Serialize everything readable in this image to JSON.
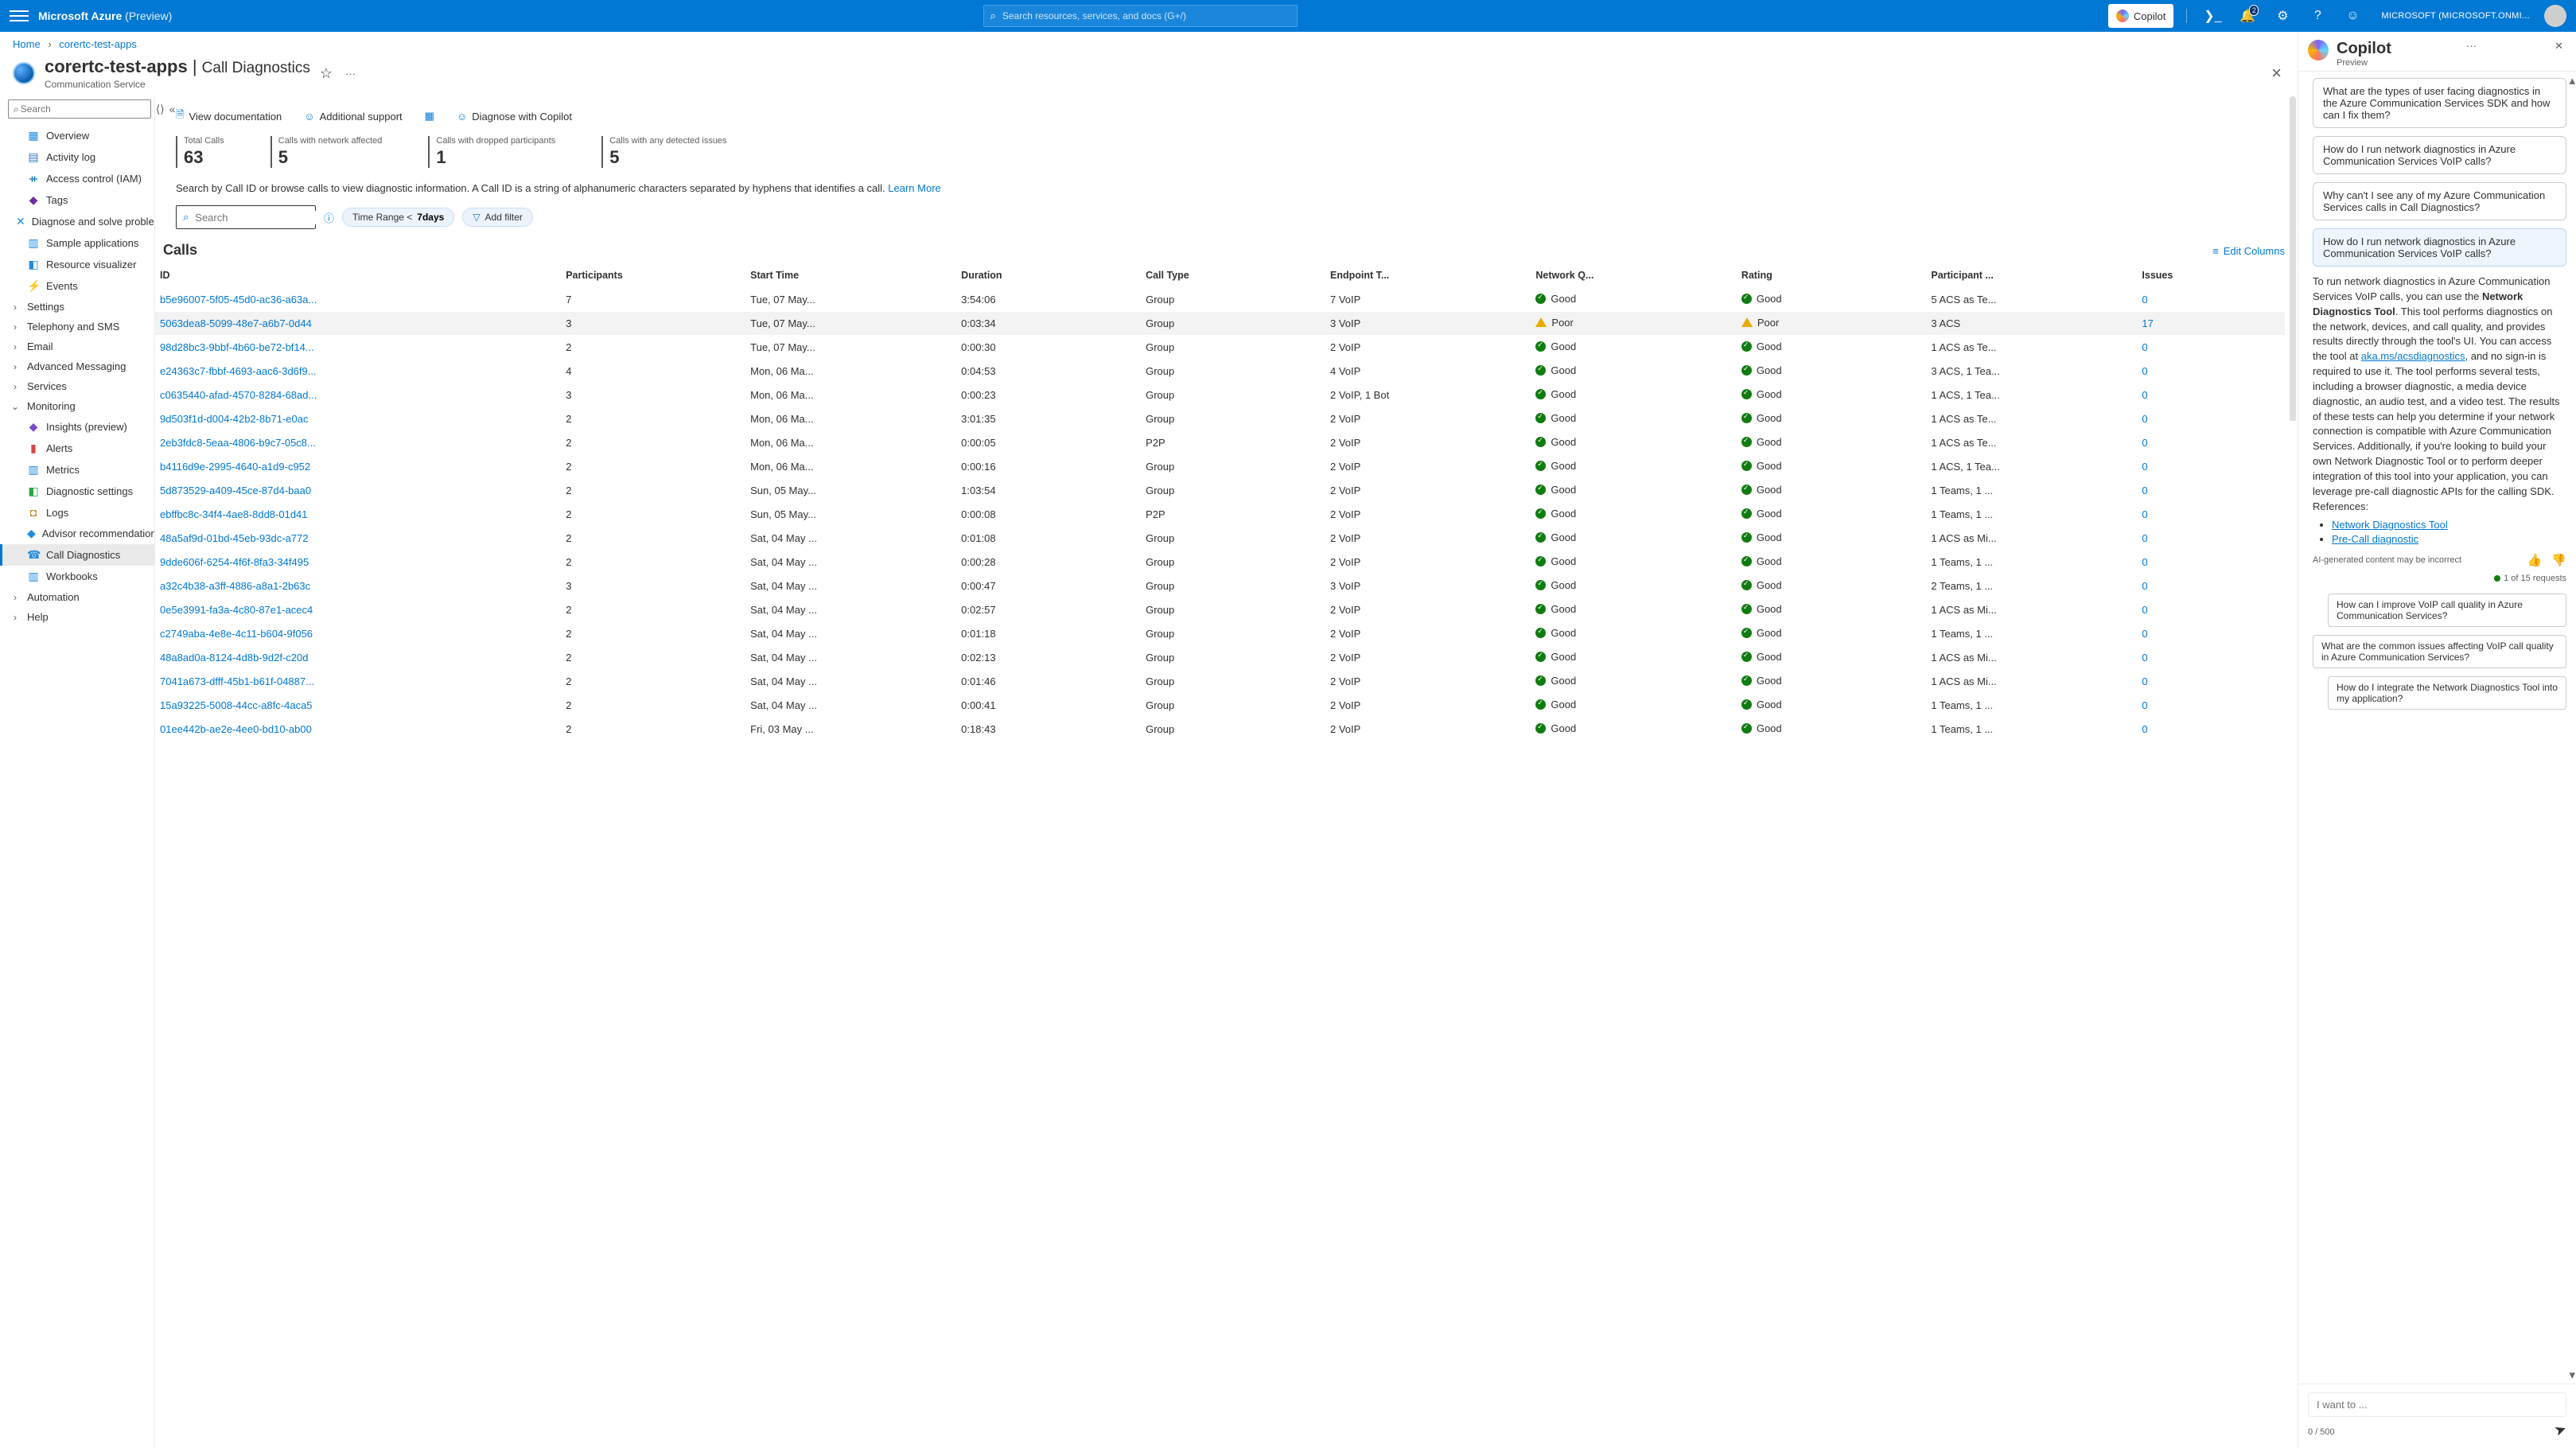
{
  "topbar": {
    "brand": "Microsoft Azure",
    "brand_suffix": " (Preview)",
    "search_placeholder": "Search resources, services, and docs (G+/)",
    "copilot_btn": "Copilot",
    "account": "MICROSOFT (MICROSOFT.ONMI...",
    "notif_count": "2"
  },
  "breadcrumb": {
    "home": "Home",
    "current": "corertc-test-apps"
  },
  "page": {
    "resource": "corertc-test-apps",
    "blade": "Call Diagnostics",
    "service_type": "Communication Service"
  },
  "svc_search_placeholder": "Search",
  "menu": {
    "items": [
      {
        "icon": "▦",
        "label": "Overview",
        "color": "#1f8bde"
      },
      {
        "icon": "▤",
        "label": "Activity log",
        "color": "#3575c0"
      },
      {
        "icon": "ᚑ",
        "label": "Access control (IAM)",
        "color": "#0f7bc2"
      },
      {
        "icon": "◆",
        "label": "Tags",
        "color": "#6b2ea3"
      },
      {
        "icon": "✕",
        "label": "Diagnose and solve problems",
        "color": "#1f8bde"
      },
      {
        "icon": "▥",
        "label": "Sample applications",
        "color": "#1f8bde"
      },
      {
        "icon": "◧",
        "label": "Resource visualizer",
        "color": "#1f8bde"
      },
      {
        "icon": "⚡",
        "label": "Events",
        "color": "#f2b200"
      }
    ],
    "groups": [
      {
        "chev": "›",
        "label": "Settings"
      },
      {
        "chev": "›",
        "label": "Telephony and SMS"
      },
      {
        "chev": "›",
        "label": "Email"
      },
      {
        "chev": "›",
        "label": "Advanced Messaging"
      },
      {
        "chev": "›",
        "label": "Services"
      }
    ],
    "monitoring": {
      "label": "Monitoring",
      "items": [
        {
          "icon": "◆",
          "label": "Insights (preview)",
          "color": "#7a49c9"
        },
        {
          "icon": "▮",
          "label": "Alerts",
          "color": "#d64343"
        },
        {
          "icon": "▥",
          "label": "Metrics",
          "color": "#1f8bde"
        },
        {
          "icon": "◧",
          "label": "Diagnostic settings",
          "color": "#28a745"
        },
        {
          "icon": "◘",
          "label": "Logs",
          "color": "#c78b27"
        },
        {
          "icon": "◆",
          "label": "Advisor recommendations",
          "color": "#1f8bde"
        },
        {
          "icon": "☎",
          "label": "Call Diagnostics",
          "color": "#1f8bde",
          "selected": true
        },
        {
          "icon": "▥",
          "label": "Workbooks",
          "color": "#1f8bde"
        }
      ]
    },
    "automation": {
      "chev": "›",
      "label": "Automation"
    },
    "help": {
      "chev": "›",
      "label": "Help"
    }
  },
  "commands": {
    "view_docs": "View documentation",
    "addl_support": "Additional support",
    "copilot": "Diagnose with Copilot"
  },
  "stats": [
    {
      "label": "Total Calls",
      "value": "63"
    },
    {
      "label": "Calls with network affected",
      "value": "5"
    },
    {
      "label": "Calls with dropped participants",
      "value": "1"
    },
    {
      "label": "Calls with any detected issues",
      "value": "5"
    }
  ],
  "instructions": {
    "text": "Search by Call ID or browse calls to view diagnostic information. A Call ID is a string of alphanumeric characters separated by hyphens that identifies a call.",
    "learn_more": "Learn More"
  },
  "search_placeholder": "Search",
  "filters": {
    "time_prefix": "Time Range <",
    "time_value": "7days",
    "add_filter": "Add filter"
  },
  "table": {
    "title": "Calls",
    "edit_columns": "Edit Columns",
    "columns": [
      "ID",
      "Participants",
      "Start Time",
      "Duration",
      "Call Type",
      "Endpoint T...",
      "Network Q...",
      "Rating",
      "Participant ...",
      "Issues"
    ],
    "rows": [
      {
        "id": "b5e96007-5f05-45d0-ac36-a63a...",
        "p": "7",
        "t": "Tue, 07 May...",
        "d": "3:54:06",
        "ct": "Group",
        "et": "7 VoIP",
        "nq": "Good",
        "r": "Good",
        "pt": "5 ACS as Te...",
        "iss": "0"
      },
      {
        "id": "5063dea8-5099-48e7-a6b7-0d44",
        "p": "3",
        "t": "Tue, 07 May...",
        "d": "0:03:34",
        "ct": "Group",
        "et": "3 VoIP",
        "nq": "Poor",
        "r": "Poor",
        "pt": "3 ACS",
        "iss": "17",
        "hl": true
      },
      {
        "id": "98d28bc3-9bbf-4b60-be72-bf14...",
        "p": "2",
        "t": "Tue, 07 May...",
        "d": "0:00:30",
        "ct": "Group",
        "et": "2 VoIP",
        "nq": "Good",
        "r": "Good",
        "pt": "1 ACS as Te...",
        "iss": "0"
      },
      {
        "id": "e24363c7-fbbf-4693-aac6-3d6f9...",
        "p": "4",
        "t": "Mon, 06 Ma...",
        "d": "0:04:53",
        "ct": "Group",
        "et": "4 VoIP",
        "nq": "Good",
        "r": "Good",
        "pt": "3 ACS, 1 Tea...",
        "iss": "0"
      },
      {
        "id": "c0635440-afad-4570-8284-68ad...",
        "p": "3",
        "t": "Mon, 06 Ma...",
        "d": "0:00:23",
        "ct": "Group",
        "et": "2 VoIP, 1 Bot",
        "nq": "Good",
        "r": "Good",
        "pt": "1 ACS, 1 Tea...",
        "iss": "0"
      },
      {
        "id": "9d503f1d-d004-42b2-8b71-e0ac",
        "p": "2",
        "t": "Mon, 06 Ma...",
        "d": "3:01:35",
        "ct": "Group",
        "et": "2 VoIP",
        "nq": "Good",
        "r": "Good",
        "pt": "1 ACS as Te...",
        "iss": "0"
      },
      {
        "id": "2eb3fdc8-5eaa-4806-b9c7-05c8...",
        "p": "2",
        "t": "Mon, 06 Ma...",
        "d": "0:00:05",
        "ct": "P2P",
        "et": "2 VoIP",
        "nq": "Good",
        "r": "Good",
        "pt": "1 ACS as Te...",
        "iss": "0"
      },
      {
        "id": "b4116d9e-2995-4640-a1d9-c952",
        "p": "2",
        "t": "Mon, 06 Ma...",
        "d": "0:00:16",
        "ct": "Group",
        "et": "2 VoIP",
        "nq": "Good",
        "r": "Good",
        "pt": "1 ACS, 1 Tea...",
        "iss": "0"
      },
      {
        "id": "5d873529-a409-45ce-87d4-baa0",
        "p": "2",
        "t": "Sun, 05 May...",
        "d": "1:03:54",
        "ct": "Group",
        "et": "2 VoIP",
        "nq": "Good",
        "r": "Good",
        "pt": "1 Teams, 1 ...",
        "iss": "0"
      },
      {
        "id": "ebffbc8c-34f4-4ae8-8dd8-01d41",
        "p": "2",
        "t": "Sun, 05 May...",
        "d": "0:00:08",
        "ct": "P2P",
        "et": "2 VoIP",
        "nq": "Good",
        "r": "Good",
        "pt": "1 Teams, 1 ...",
        "iss": "0"
      },
      {
        "id": "48a5af9d-01bd-45eb-93dc-a772",
        "p": "2",
        "t": "Sat, 04 May ...",
        "d": "0:01:08",
        "ct": "Group",
        "et": "2 VoIP",
        "nq": "Good",
        "r": "Good",
        "pt": "1 ACS as Mi...",
        "iss": "0"
      },
      {
        "id": "9dde606f-6254-4f6f-8fa3-34f495",
        "p": "2",
        "t": "Sat, 04 May ...",
        "d": "0:00:28",
        "ct": "Group",
        "et": "2 VoIP",
        "nq": "Good",
        "r": "Good",
        "pt": "1 Teams, 1 ...",
        "iss": "0"
      },
      {
        "id": "a32c4b38-a3ff-4886-a8a1-2b63c",
        "p": "3",
        "t": "Sat, 04 May ...",
        "d": "0:00:47",
        "ct": "Group",
        "et": "3 VoIP",
        "nq": "Good",
        "r": "Good",
        "pt": "2 Teams, 1 ...",
        "iss": "0"
      },
      {
        "id": "0e5e3991-fa3a-4c80-87e1-acec4",
        "p": "2",
        "t": "Sat, 04 May ...",
        "d": "0:02:57",
        "ct": "Group",
        "et": "2 VoIP",
        "nq": "Good",
        "r": "Good",
        "pt": "1 ACS as Mi...",
        "iss": "0"
      },
      {
        "id": "c2749aba-4e8e-4c11-b604-9f056",
        "p": "2",
        "t": "Sat, 04 May ...",
        "d": "0:01:18",
        "ct": "Group",
        "et": "2 VoIP",
        "nq": "Good",
        "r": "Good",
        "pt": "1 Teams, 1 ...",
        "iss": "0"
      },
      {
        "id": "48a8ad0a-8124-4d8b-9d2f-c20d",
        "p": "2",
        "t": "Sat, 04 May ...",
        "d": "0:02:13",
        "ct": "Group",
        "et": "2 VoIP",
        "nq": "Good",
        "r": "Good",
        "pt": "1 ACS as Mi...",
        "iss": "0"
      },
      {
        "id": "7041a673-dfff-45b1-b61f-04887...",
        "p": "2",
        "t": "Sat, 04 May ...",
        "d": "0:01:46",
        "ct": "Group",
        "et": "2 VoIP",
        "nq": "Good",
        "r": "Good",
        "pt": "1 ACS as Mi...",
        "iss": "0"
      },
      {
        "id": "15a93225-5008-44cc-a8fc-4aca5",
        "p": "2",
        "t": "Sat, 04 May ...",
        "d": "0:00:41",
        "ct": "Group",
        "et": "2 VoIP",
        "nq": "Good",
        "r": "Good",
        "pt": "1 Teams, 1 ...",
        "iss": "0"
      },
      {
        "id": "01ee442b-ae2e-4ee0-bd10-ab00",
        "p": "2",
        "t": "Fri, 03 May ...",
        "d": "0:18:43",
        "ct": "Group",
        "et": "2 VoIP",
        "nq": "Good",
        "r": "Good",
        "pt": "1 Teams, 1 ...",
        "iss": "0"
      }
    ]
  },
  "copilot": {
    "title": "Copilot",
    "preview": "Preview",
    "suggestions": [
      "What are the types of user facing diagnostics in the Azure Communication Services SDK and how can I fix them?",
      "How do I run network diagnostics in Azure Communication Services VoIP calls?",
      "Why can't I see any of my Azure Communication Services calls in Call Diagnostics?"
    ],
    "user_msg": "How do I run network diagnostics in Azure Communication Services VoIP calls?",
    "answer_parts": {
      "p1": "To run network diagnostics in Azure Communication Services VoIP calls, you can use the ",
      "bold": "Network Diagnostics Tool",
      "p2": ". This tool performs diagnostics on the network, devices, and call quality, and provides results directly through the tool's UI. You can access the tool at ",
      "link1_text": "aka.ms/acsdiagnostics",
      "p3": ", and no sign-in is required to use it. The tool performs several tests, including a browser diagnostic, a media device diagnostic, an audio test, and a video test. The results of these tests can help you determine if your network connection is compatible with Azure Communication Services. Additionally, if you're looking to build your own Network Diagnostic Tool or to perform deeper integration of this tool into your application, you can leverage pre-call diagnostic APIs for the calling SDK. References:"
    },
    "refs": [
      "Network Diagnostics Tool",
      "Pre-Call diagnostic"
    ],
    "disclaimer": "AI-generated content may be incorrect",
    "quota": "1 of 15 requests",
    "followups": [
      "How can I improve VoIP call quality in Azure Communication Services?",
      "What are the common issues affecting VoIP call quality in Azure Communication Services?",
      "How do I integrate the Network Diagnostics Tool into my application?"
    ],
    "input_placeholder": "I want to ...",
    "char_count": "0 / 500"
  }
}
